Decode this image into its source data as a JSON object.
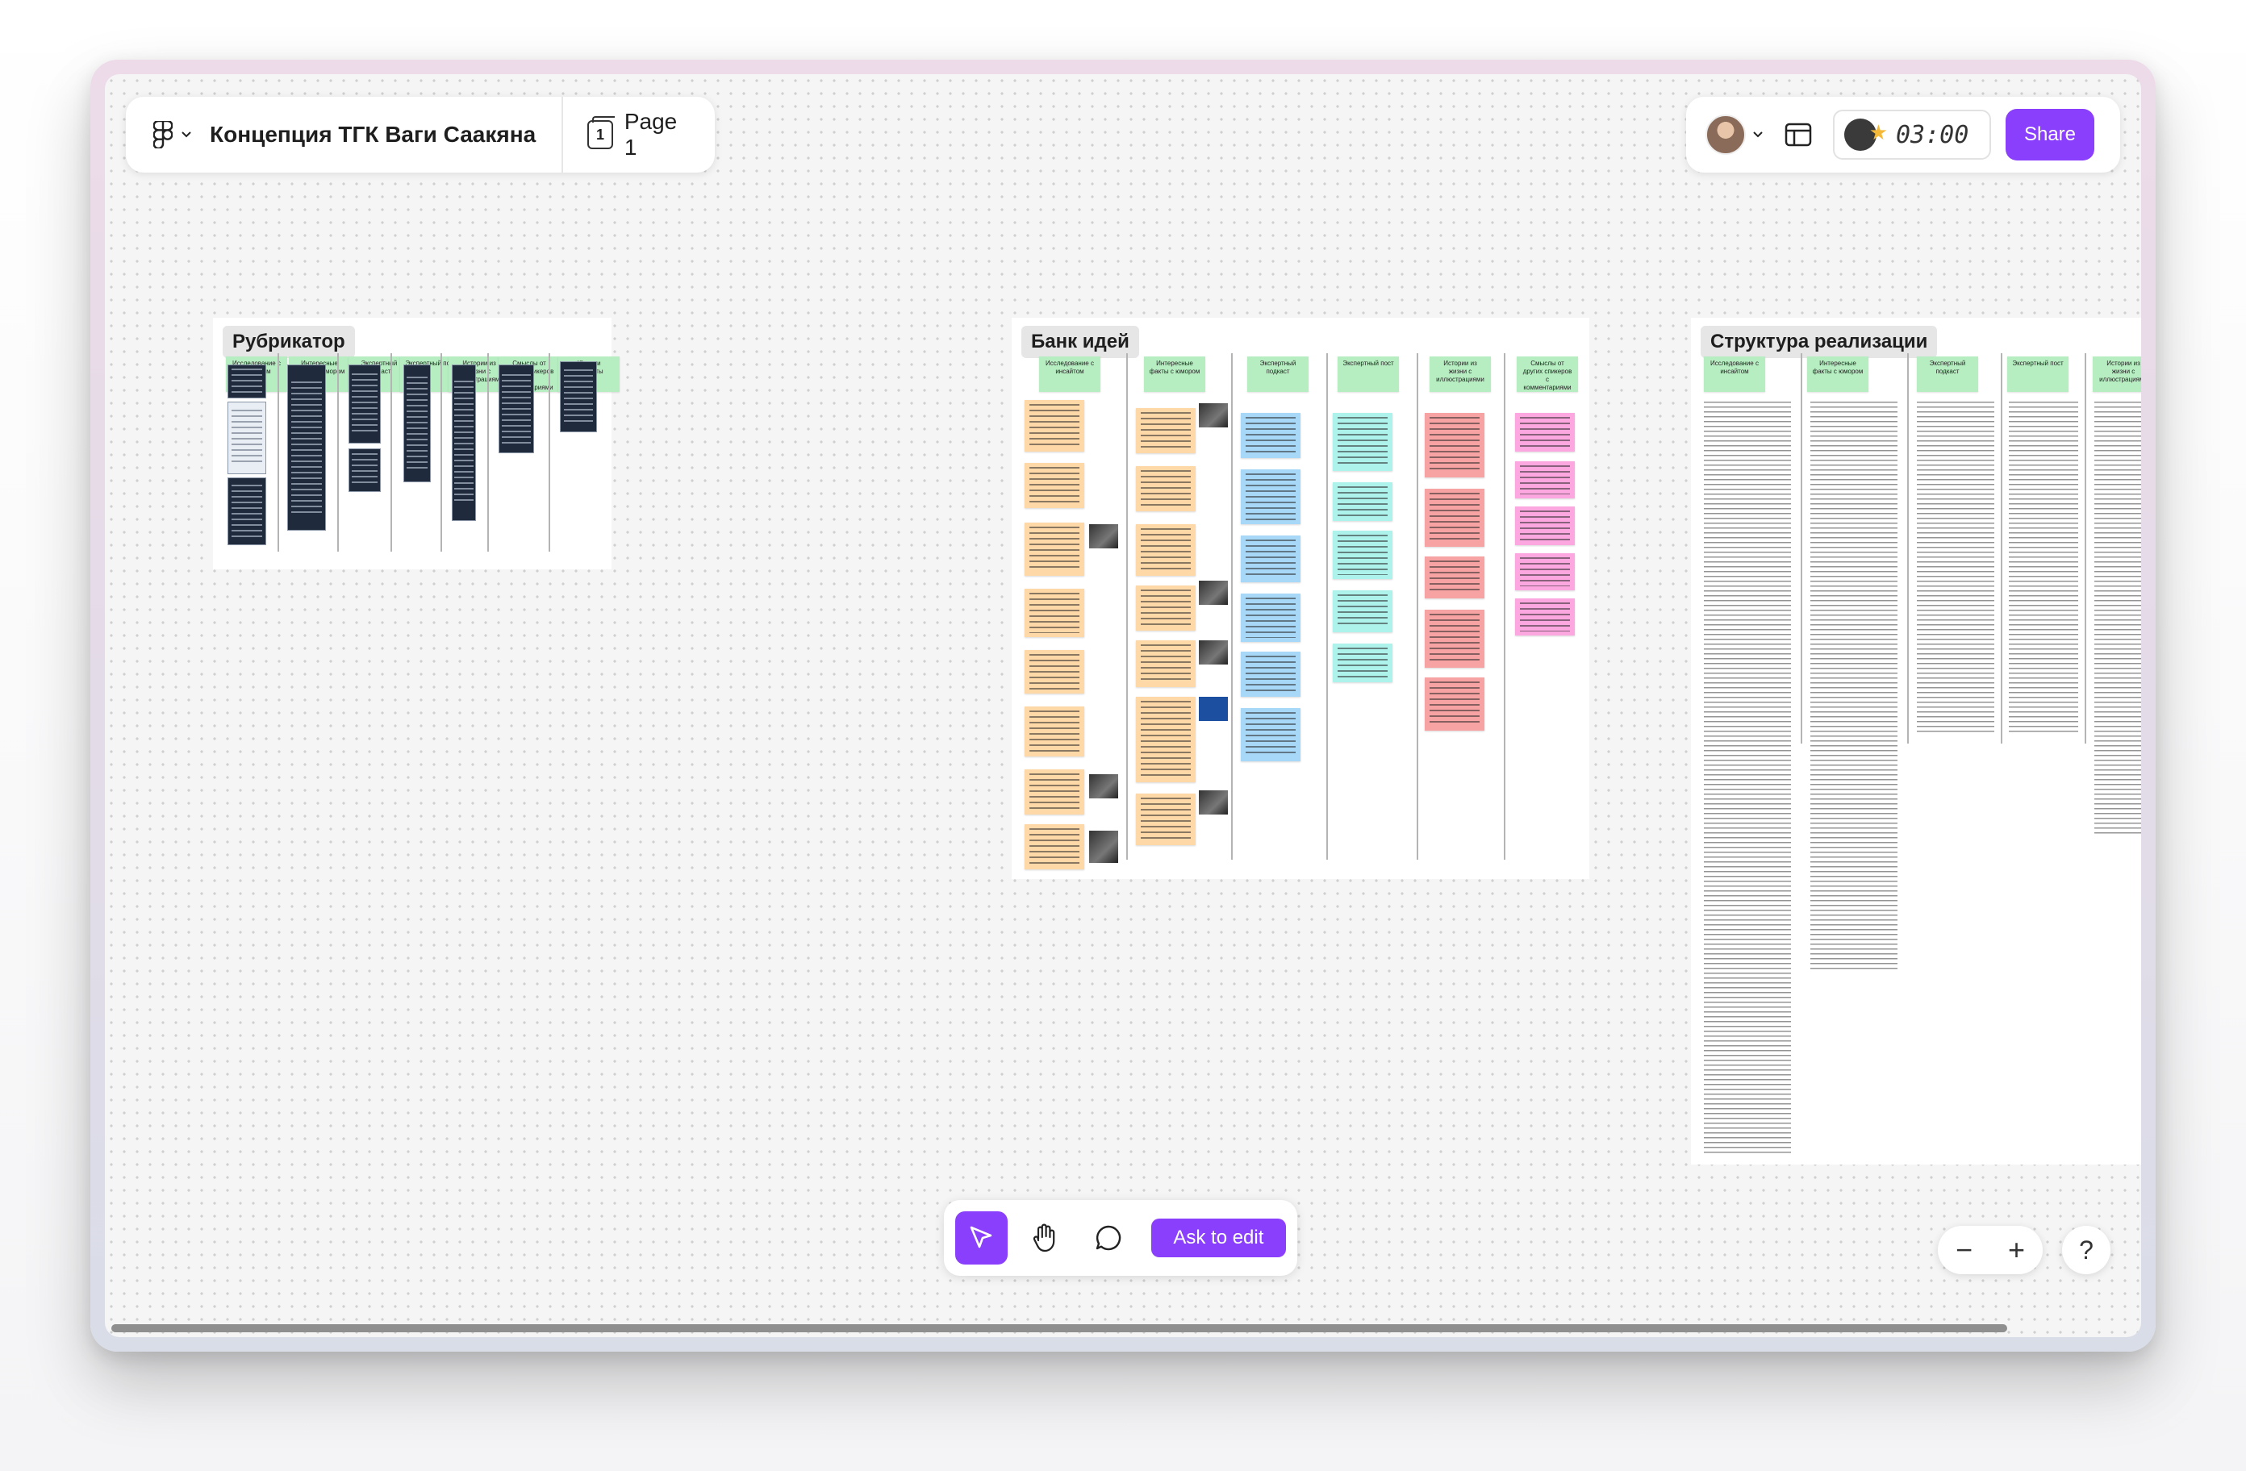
{
  "file": {
    "title": "Концепция ТГК Ваги Саакяна",
    "page_label": "Page 1",
    "page_number": "1"
  },
  "header_right": {
    "timer": "03:00",
    "share_label": "Share"
  },
  "sections": [
    {
      "title": "Рубрикатор",
      "columns": [
        "Исследование с инсайтом",
        "Интересные факты с юмором",
        "Экспертный подкаст",
        "Экспертный пост",
        "Истории из жизни с иллюстрациями",
        "Смыслы от других спикеров с комментариями",
        "Юмор и анекдоты"
      ]
    },
    {
      "title": "Банк идей",
      "columns": [
        "Исследование с инсайтом",
        "Интересные факты с юмором",
        "Экспертный подкаст",
        "Экспертный пост",
        "Истории из жизни с иллюстрациями",
        "Смыслы от других спикеров с комментариями"
      ]
    },
    {
      "title": "Структура реализации",
      "columns": [
        "Исследование с инсайтом",
        "Интересные факты с юмором",
        "Экспертный подкаст",
        "Экспертный пост",
        "Истории из жизни с иллюстрациями"
      ]
    }
  ],
  "colors": {
    "accent": "#8a3ffc",
    "header_sticky": "#b7eec1",
    "sticky_orange": "#ffd8a8",
    "sticky_blue": "#a8d8f8",
    "sticky_cyan": "#aef2ec",
    "sticky_red": "#f8a3a3",
    "sticky_pink": "#fca7e0"
  },
  "toolbar": {
    "ask_label": "Ask to edit"
  },
  "zoom": {
    "minus": "−",
    "plus": "+",
    "help": "?"
  },
  "icons": [
    "figma-icon",
    "chevron-down-icon",
    "page-icon",
    "avatar",
    "layout-icon",
    "timer-icon",
    "cursor-icon",
    "hand-icon",
    "comment-icon",
    "minus-icon",
    "plus-icon",
    "help-icon"
  ]
}
